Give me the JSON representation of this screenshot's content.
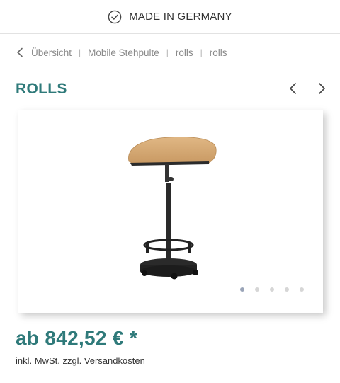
{
  "header": {
    "tagline": "MADE IN GERMANY",
    "icon": "check-circle-icon"
  },
  "breadcrumb": {
    "back_icon": "chevron-left-icon",
    "items": [
      "Übersicht",
      "Mobile Stehpulte",
      "rolls",
      "rolls"
    ],
    "separator": "|"
  },
  "product": {
    "title": "ROLLS",
    "image_alt": "Mobile standing desk with wooden top",
    "price": "ab 842,52 € *",
    "tax_note": "inkl. MwSt. zzgl. Versandkosten"
  },
  "gallery": {
    "slide_count": 5,
    "active_index": 0
  },
  "colors": {
    "accent": "#2f7a7a",
    "text": "#333333",
    "muted": "#8a8a8a"
  }
}
